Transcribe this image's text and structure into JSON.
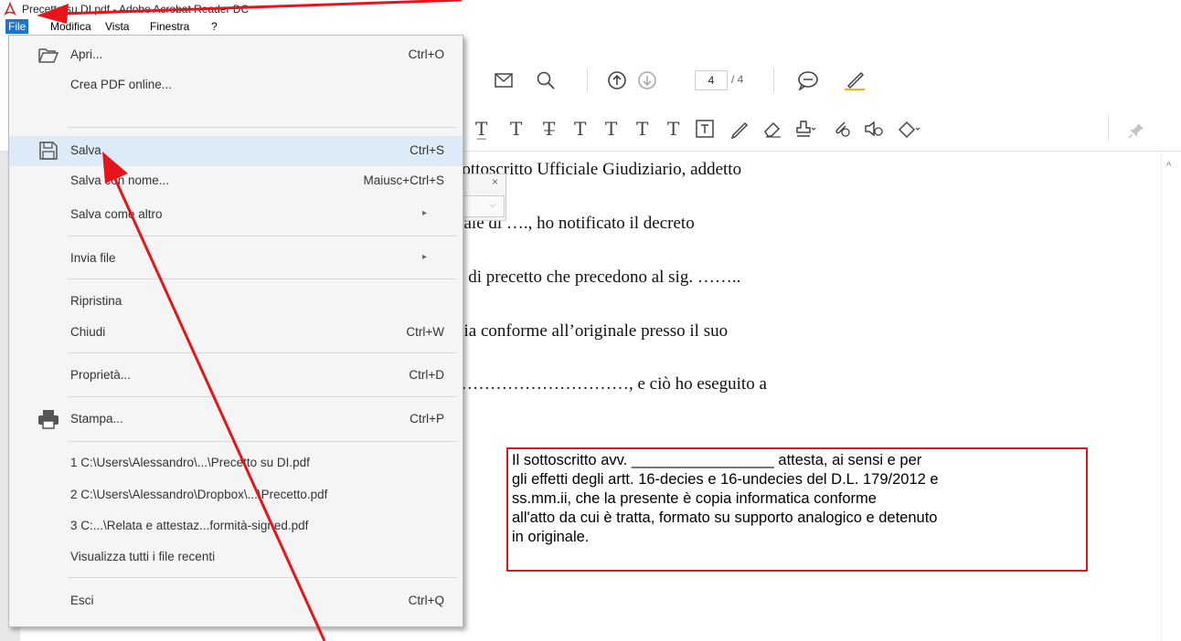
{
  "window": {
    "title": "Precetto su DI.pdf - Adobe Acrobat Reader DC",
    "icon": "pdf-app-icon"
  },
  "menubar": {
    "items": [
      "File",
      "Modifica",
      "Vista",
      "Finestra",
      "?"
    ]
  },
  "file_menu": {
    "items": [
      {
        "label": "Apri...",
        "shortcut": "Ctrl+O",
        "icon": "folder-open-icon"
      },
      {
        "label": "Crea PDF online...",
        "shortcut": ""
      },
      {
        "label": "Salva",
        "shortcut": "Ctrl+S",
        "icon": "save-icon",
        "highlighted": true
      },
      {
        "label": "Salva con nome...",
        "shortcut": "Maiusc+Ctrl+S"
      },
      {
        "label": "Salva come altro",
        "shortcut": "",
        "submenu": true
      },
      {
        "label": "Invia file",
        "shortcut": "",
        "submenu": true
      },
      {
        "label": "Ripristina",
        "shortcut": ""
      },
      {
        "label": "Chiudi",
        "shortcut": "Ctrl+W"
      },
      {
        "label": "Proprietà...",
        "shortcut": "Ctrl+D"
      },
      {
        "label": "Stampa...",
        "shortcut": "Ctrl+P",
        "icon": "printer-icon"
      },
      {
        "label": "1 C:\\Users\\Alessandro\\...\\Precetto su DI.pdf",
        "shortcut": ""
      },
      {
        "label": "2 C:\\Users\\Alessandro\\Dropbox\\...\\Precetto.pdf",
        "shortcut": ""
      },
      {
        "label": "3 C:...\\Relata e attestaz...formità-signed.pdf",
        "shortcut": ""
      },
      {
        "label": "Visualizza tutti i file recenti",
        "shortcut": ""
      },
      {
        "label": "Esci",
        "shortcut": "Ctrl+Q"
      }
    ]
  },
  "toolbar": {
    "page_current": "4",
    "page_total": "/ 4"
  },
  "document": {
    "lines": [
      "sottoscritto Ufficiale Giudiziario, addetto",
      "nale di …., ho notificato il decreto",
      "o di precetto che precedono al sig. ……..",
      "pia conforme all’originale presso il suo",
      "…………………………, e ciò ho eseguito a"
    ],
    "certification": [
      "Il sottoscritto avv. _________________ attesta, ai sensi e per",
      "gli effetti degli artt. 16-decies e 16-undecies del D.L. 179/2012 e",
      "ss.mm.ii, che la presente è copia informatica conforme",
      "all'atto da cui è tratta, formato su supporto analogico e detenuto",
      "in originale."
    ]
  },
  "colors": {
    "menu_active": "#1e73d1",
    "highlight_row": "#dcebf7",
    "annotation_red": "#e8141c",
    "cert_border": "#d71920"
  }
}
